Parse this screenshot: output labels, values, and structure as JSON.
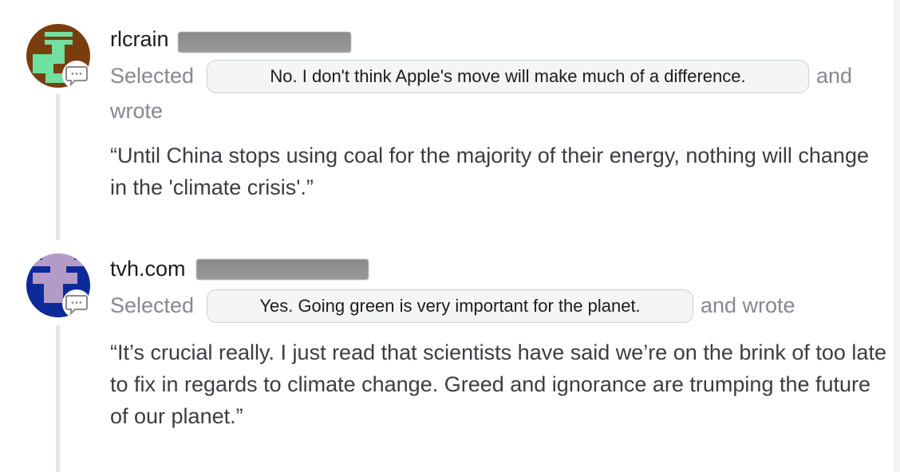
{
  "comments": [
    {
      "username": "rlcrain",
      "selected_label": "Selected",
      "selected_option": "No. I don't think Apple's move will make much of a difference.",
      "and_label": "and",
      "wrote_label": "wrote",
      "quote": "“Until China stops using coal for the majority of their energy, nothing will change in the 'climate crisis'.”",
      "avatar_colors": [
        "#7a3d0e",
        "#6fe0a0"
      ],
      "icon": "comment-icon"
    },
    {
      "username": "tvh.com",
      "selected_label": "Selected",
      "selected_option": "Yes. Going green is very important for the planet.",
      "and_wrote_label": "and wrote",
      "quote": "“It’s crucial really. I just read that scientists have said we’re on the brink of too late to fix in regards to climate change. Greed and ignorance are trumping the future of our planet.”",
      "avatar_colors": [
        "#0d2a9a",
        "#b39bc8"
      ],
      "icon": "comment-icon"
    }
  ]
}
